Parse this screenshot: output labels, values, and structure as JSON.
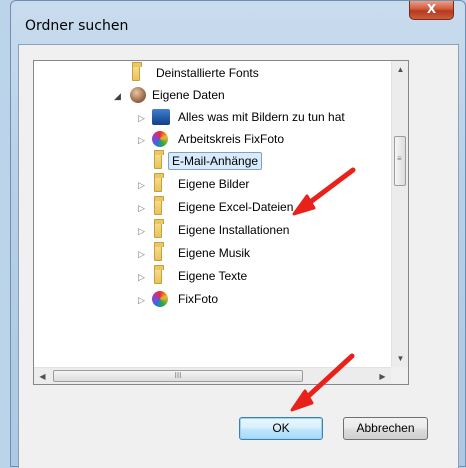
{
  "window": {
    "title": "Ordner suchen",
    "close_glyph": "X"
  },
  "tree": {
    "items": [
      {
        "label": "Deinstallierte Fonts",
        "icon": "folder-icon",
        "expander": "none"
      },
      {
        "label": "Eigene Daten",
        "icon": "user-avatar-icon",
        "expander": "expanded"
      },
      {
        "label": "Alles was mit Bildern zu tun hat",
        "icon": "picture-library-icon",
        "expander": "collapsed"
      },
      {
        "label": "Arbeitskreis FixFoto",
        "icon": "colorful-app-icon",
        "expander": "collapsed"
      },
      {
        "label": "E-Mail-Anhänge",
        "icon": "folder-icon",
        "expander": "none",
        "selected": true
      },
      {
        "label": "Eigene Bilder",
        "icon": "folder-icon",
        "expander": "collapsed"
      },
      {
        "label": "Eigene Excel-Dateien",
        "icon": "folder-icon",
        "expander": "collapsed"
      },
      {
        "label": "Eigene Installationen",
        "icon": "folder-icon",
        "expander": "collapsed"
      },
      {
        "label": "Eigene Musik",
        "icon": "folder-icon",
        "expander": "collapsed"
      },
      {
        "label": "Eigene Texte",
        "icon": "folder-icon",
        "expander": "collapsed"
      },
      {
        "label": "FixFoto",
        "icon": "fixfoto-app-icon",
        "expander": "collapsed"
      }
    ]
  },
  "scrollbars": {
    "vertical_thumb_grip": "≡",
    "horizontal_thumb_grip": "III"
  },
  "buttons": {
    "ok_label": "OK",
    "cancel_label": "Abbrechen"
  },
  "annotations": {
    "arrow_color": "#e8211b"
  }
}
